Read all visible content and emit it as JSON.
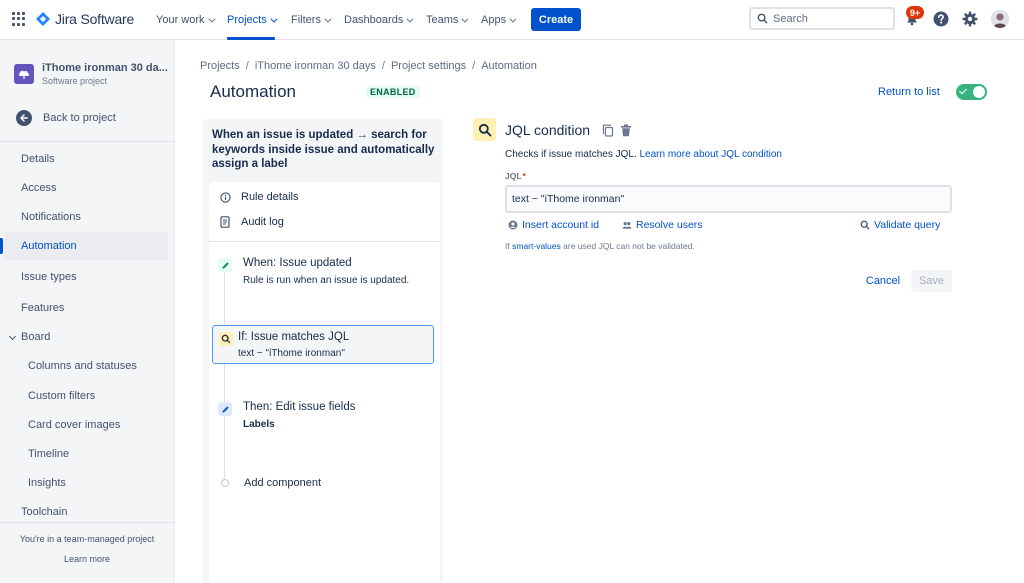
{
  "topnav": {
    "brand": "Jira Software",
    "nav": [
      {
        "label": "Your work"
      },
      {
        "label": "Projects"
      },
      {
        "label": "Filters"
      },
      {
        "label": "Dashboards"
      },
      {
        "label": "Teams"
      },
      {
        "label": "Apps"
      }
    ],
    "active_nav": "Projects",
    "create_label": "Create",
    "search_placeholder": "Search",
    "notifications_badge": "9+",
    "brand_color": "#0052CC"
  },
  "sidebar": {
    "project_name": "iThome ironman 30 da...",
    "project_type": "Software project",
    "back_label": "Back to project",
    "items": [
      {
        "label": "Details"
      },
      {
        "label": "Access"
      },
      {
        "label": "Notifications"
      },
      {
        "label": "Automation"
      },
      {
        "label": "Issue types"
      },
      {
        "label": "Features"
      },
      {
        "label": "Board"
      },
      {
        "label": "Columns and statuses"
      },
      {
        "label": "Custom filters"
      },
      {
        "label": "Card cover images"
      },
      {
        "label": "Timeline"
      },
      {
        "label": "Insights"
      },
      {
        "label": "Toolchain"
      }
    ],
    "active_item": "Automation",
    "footer_text": "You're in a team-managed project",
    "learn_more": "Learn more"
  },
  "breadcrumb": [
    "Projects",
    "iThome ironman 30 days",
    "Project settings",
    "Automation"
  ],
  "page": {
    "title": "Automation",
    "status_lozenge": "ENABLED",
    "return_link": "Return to list",
    "rule_enabled": true
  },
  "rule": {
    "title": "When an issue is updated → search for keywords inside issue and automatically assign a label",
    "menu": [
      {
        "label": "Rule details",
        "icon": "info-icon"
      },
      {
        "label": "Audit log",
        "icon": "document-icon"
      }
    ],
    "steps": [
      {
        "title": "When: Issue updated",
        "subtitle": "Rule is run when an issue is updated.",
        "icon": "pencil-icon",
        "color": "#E3FCEF"
      },
      {
        "title": "If: Issue matches JQL",
        "subtitle": "text ~ \"iThome ironman\"",
        "icon": "search-icon",
        "color": "#FFF0B3"
      },
      {
        "title": "Then: Edit issue fields",
        "subtitle": "Labels",
        "icon": "pencil-icon",
        "color": "#DEEBFF"
      }
    ],
    "add_component": "Add component"
  },
  "config": {
    "title": "JQL condition",
    "description": "Checks if issue matches JQL.",
    "learn_link": "Learn more about JQL condition",
    "jql_label": "JQL",
    "jql_value": "text ~ \"iThome ironman\"",
    "insert_account": "Insert account id",
    "resolve_users": "Resolve users",
    "validate_query": "Validate query",
    "hint_prefix": "If",
    "hint_link": "smart-values",
    "hint_suffix": "are used JQL can not be validated.",
    "cancel": "Cancel",
    "save": "Save"
  }
}
